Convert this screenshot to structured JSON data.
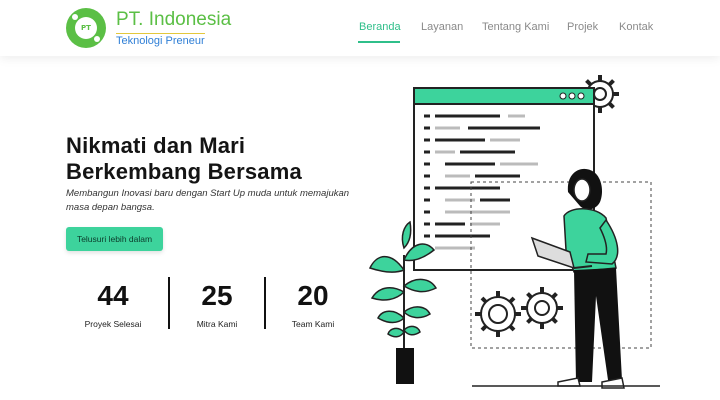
{
  "brand": {
    "title": "PT. Indonesia",
    "subtitle": "Teknologi Preneur",
    "logo_text": "PT",
    "colors": {
      "green": "#5bbf45",
      "blue": "#2f7fd6",
      "accent": "#3dd39c"
    }
  },
  "nav": {
    "items": [
      {
        "label": "Beranda",
        "active": true
      },
      {
        "label": "Layanan",
        "active": false
      },
      {
        "label": "Tentang Kami",
        "active": false
      },
      {
        "label": "Projek",
        "active": false
      },
      {
        "label": "Kontak",
        "active": false
      }
    ]
  },
  "hero": {
    "title_line1": "Nikmati dan Mari",
    "title_line2": "Berkembang Bersama",
    "description": "Membangun Inovasi baru dengan Start Up muda untuk memajukan masa depan bangsa.",
    "cta_label": "Telusuri lebih dalam"
  },
  "stats": [
    {
      "value": "44",
      "label": "Proyek Selesai"
    },
    {
      "value": "25",
      "label": "Mitra Kami"
    },
    {
      "value": "20",
      "label": "Team Kami"
    }
  ],
  "illustration": {
    "icons": [
      "code-window-icon",
      "gear-icon",
      "plant-icon",
      "person-with-laptop-icon"
    ]
  }
}
